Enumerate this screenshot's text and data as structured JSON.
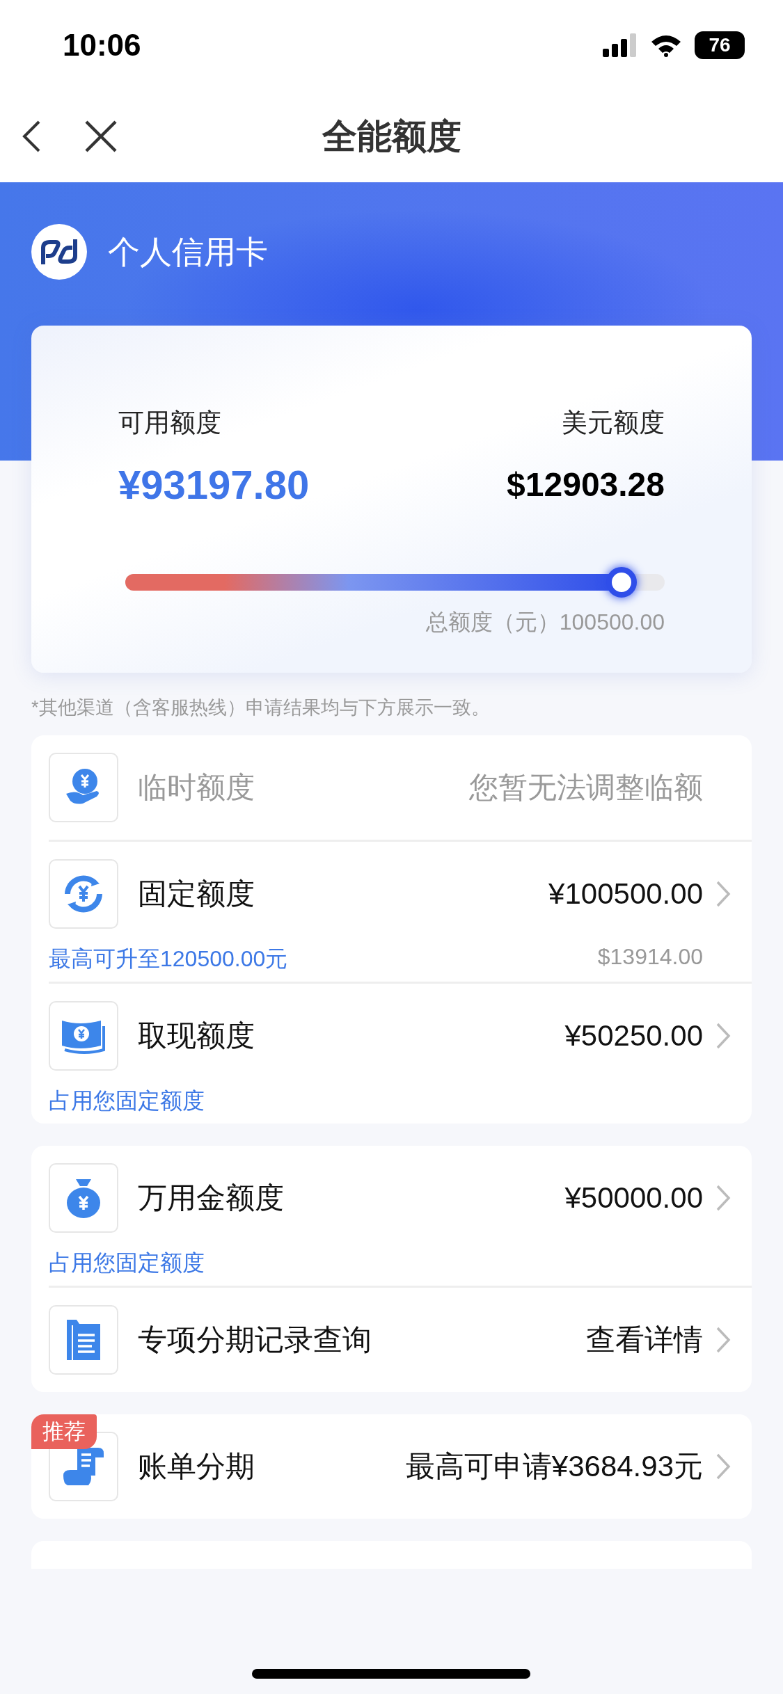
{
  "status_bar": {
    "time": "10:06",
    "battery": "76"
  },
  "nav": {
    "title": "全能额度"
  },
  "header": {
    "title": "个人信用卡"
  },
  "summary": {
    "available_label": "可用额度",
    "available_amount": "¥93197.80",
    "usd_label": "美元额度",
    "usd_amount": "$12903.28",
    "level": 0.92,
    "total": "总额度（元）100500.00"
  },
  "notice": "*其他渠道（含客服热线）申请结果均与下方展示一致。",
  "sections": [
    {
      "rows": [
        {
          "label": "临时额度",
          "value": "您暂无法调整临额",
          "disabled": true
        },
        {
          "label": "固定额度",
          "value": "¥100500.00",
          "disabled": false,
          "note": "最高可升至120500.00元",
          "usd": "$13914.00"
        },
        {
          "label": "取现额度",
          "value": "¥50250.00",
          "disabled": false,
          "note": "占用您固定额度"
        }
      ]
    },
    {
      "rows": [
        {
          "label": "万用金额度",
          "value": "¥50000.00",
          "disabled": false,
          "note": "占用您固定额度"
        },
        {
          "label": "专项分期记录查询",
          "value": "查看详情",
          "disabled": false
        }
      ]
    },
    {
      "rows": [
        {
          "label": "账单分期",
          "value": "最高可申请¥3684.93元",
          "disabled": false,
          "badge": "推荐"
        }
      ]
    }
  ]
}
